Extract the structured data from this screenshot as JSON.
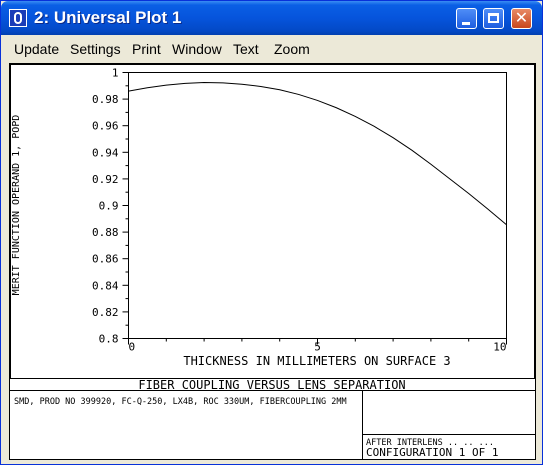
{
  "window": {
    "title": "2: Universal Plot 1"
  },
  "menu": [
    "Update",
    "Settings",
    "Print",
    "Window",
    "Text",
    "Zoom"
  ],
  "colors": {
    "titlebar": "#0654dc",
    "close_button": "#c8471d",
    "plot_line": "#000000"
  },
  "footer": {
    "title": "FIBER COUPLING VERSUS LENS SEPARATION",
    "description": "SMD, PROD NO 399920, FC-Q-250, LX4B, ROC 330UM, FIBERCOUPLING 2MM",
    "note": "AFTER INTERLENS .. .. ...",
    "configuration": "CONFIGURATION 1 OF 1"
  },
  "chart_data": {
    "type": "line",
    "title": "FIBER COUPLING VERSUS LENS SEPARATION",
    "xlabel": "THICKNESS IN MILLIMETERS ON SURFACE 3",
    "ylabel": "MERIT FUNCTION OPERAND 1, POPD",
    "xlim": [
      0,
      10
    ],
    "ylim": [
      0.8,
      1
    ],
    "xticks": [
      "0",
      "5",
      "10"
    ],
    "yticks": [
      "1",
      "0.98",
      "0.96",
      "0.94",
      "0.92",
      "0.9",
      "0.88",
      "0.86",
      "0.84",
      "0.82",
      "0.8"
    ],
    "grid": false,
    "series": [
      {
        "x": [
          0,
          0.5,
          1,
          1.5,
          2,
          2.5,
          3,
          3.5,
          4,
          4.5,
          5,
          5.5,
          6,
          6.5,
          7,
          7.5,
          8,
          8.5,
          9,
          9.5,
          10
        ],
        "values": [
          0.986,
          0.9885,
          0.9905,
          0.9918,
          0.9925,
          0.9922,
          0.9912,
          0.9895,
          0.987,
          0.9835,
          0.979,
          0.9735,
          0.967,
          0.9595,
          0.951,
          0.9415,
          0.931,
          0.92,
          0.909,
          0.8975,
          0.8855
        ]
      }
    ]
  }
}
